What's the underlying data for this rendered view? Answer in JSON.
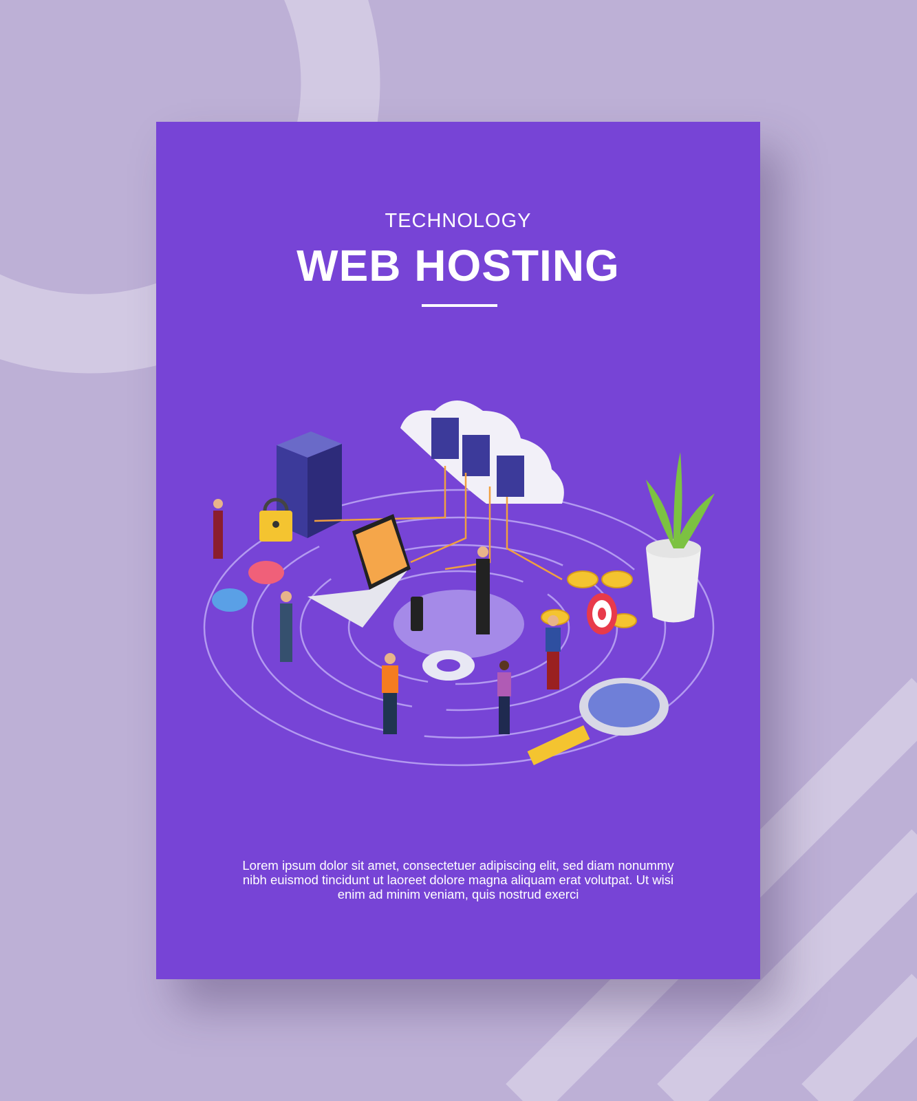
{
  "poster": {
    "kicker": "TECHNOLOGY",
    "title": "WEB HOSTING",
    "body": "Lorem ipsum dolor sit amet, consectetuer adipiscing elit, sed diam nonummy nibh euismod tincidunt ut laoreet dolore magna aliquam erat volutpat. Ut wisi enim ad minim veniam, quis nostrud exerci"
  },
  "colors": {
    "background": "#bdb0d6",
    "poster": "#7744d6",
    "accent": "#f4c430"
  }
}
